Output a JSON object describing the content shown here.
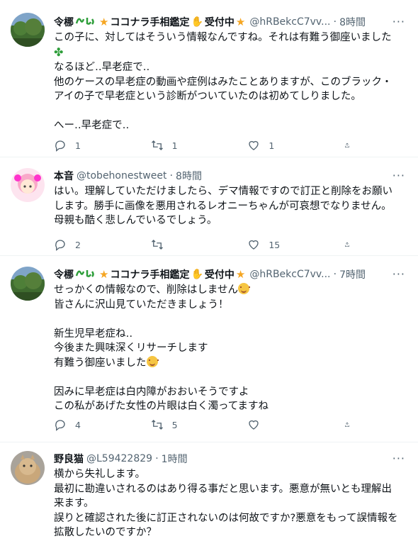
{
  "tweets": [
    {
      "name_prefix": "令梛",
      "name_suffix": "ココナラ手相鑑定",
      "name_tail": "受付中",
      "handle": "@hRBekcC7vv...",
      "time": "8時間",
      "text": "この子に、対してはそういう情報なんですね。それは有難う御座いました",
      "text_after": "なるほど‥早老症で‥\n他のケースの早老症の動画や症例はみたことありますが、このブラック・\nアイの子で早老症という診断がついていたのは初めてしりました。\n\nへー‥早老症で‥",
      "replies": "1",
      "retweets": "1",
      "likes": "1"
    },
    {
      "name": "本音",
      "handle": "@tobehonestweet",
      "time": "8時間",
      "text": "はい。理解していただけましたら、デマ情報ですので訂正と削除をお願い\nします。勝手に画像を悪用されるレオニーちゃんが可哀想でなりません。\n母親も酷く悲しんでいるでしょう。",
      "replies": "2",
      "retweets": "",
      "likes": "15"
    },
    {
      "name_prefix": "令梛",
      "name_suffix": "ココナラ手相鑑定",
      "name_tail": "受付中",
      "handle": "@hRBekcC7vv...",
      "time": "7時間",
      "line1": "せっかくの情報なので、削除はしません",
      "line2": "皆さんに沢山見ていただきましょう！\n\n新生児早老症ね‥\n今後また興味深くリサーチします\n有難う御座いました",
      "line3": "\n因みに早老症は白内障がおおいそうですよ\nこの私があげた女性の片眼は白く濁ってますね",
      "replies": "4",
      "retweets": "5",
      "likes": ""
    },
    {
      "name": "野良猫",
      "handle": "@L59422829",
      "time": "1時間",
      "text": "横から失礼します。\n最初に勘違いされるのはあり得る事だと思います。悪意が無いとも理解出\n来ます。\n誤りと確認された後に訂正されないのは何故ですか?悪意をもって誤情報を\n拡散したいのですか？"
    }
  ],
  "colors": {
    "text": "#0f1419",
    "muted": "#536471",
    "border": "#eff3f4",
    "star": "#f5a623",
    "green": "#2e9e3a"
  },
  "icons": [
    "reply-icon",
    "retweet-icon",
    "like-icon",
    "share-icon",
    "more-icon",
    "star-icon",
    "hand-icon",
    "clover-icon",
    "smile-icon"
  ]
}
